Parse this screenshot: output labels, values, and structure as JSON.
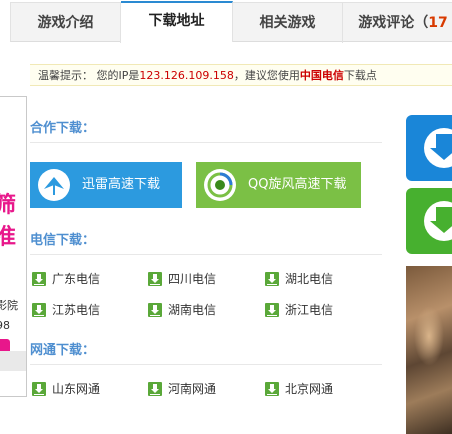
{
  "tabs": [
    {
      "label": "游戏介绍",
      "active": false
    },
    {
      "label": "下载地址",
      "active": true
    },
    {
      "label": "相关游戏",
      "active": false
    },
    {
      "label": "游戏评论（",
      "count": "17",
      "active": false
    }
  ],
  "notice": {
    "prefix": "温馨提示：  您的IP是",
    "ip": "123.126.109.158",
    "middle": "，建议您使用",
    "isp": "中国电信",
    "suffix": "下载点"
  },
  "sections": {
    "partner": "合作下载：",
    "telecom": "电信下载：",
    "netcom": "网通下载："
  },
  "partner_buttons": {
    "xunlei": "迅雷高速下载",
    "qq": "QQ旋风高速下载"
  },
  "telecom_links": [
    "广东电信",
    "四川电信",
    "湖北电信",
    "江苏电信",
    "湖南电信",
    "浙江电信"
  ],
  "netcom_links": [
    "山东网通",
    "河南网通",
    "北京网通"
  ],
  "left_panel": {
    "big1": "筛",
    "big2": "准",
    "small1": "影院",
    "small2": "98"
  },
  "colors": {
    "accent_blue": "#2c9adf",
    "accent_green": "#7bc045",
    "link_icon_green": "#5aa839",
    "ip_red": "#cc0000",
    "panel_pink": "#e8178b"
  },
  "icons": [
    "xunlei-bird-icon",
    "qq-whirlwind-icon",
    "download-arrow-icon"
  ]
}
